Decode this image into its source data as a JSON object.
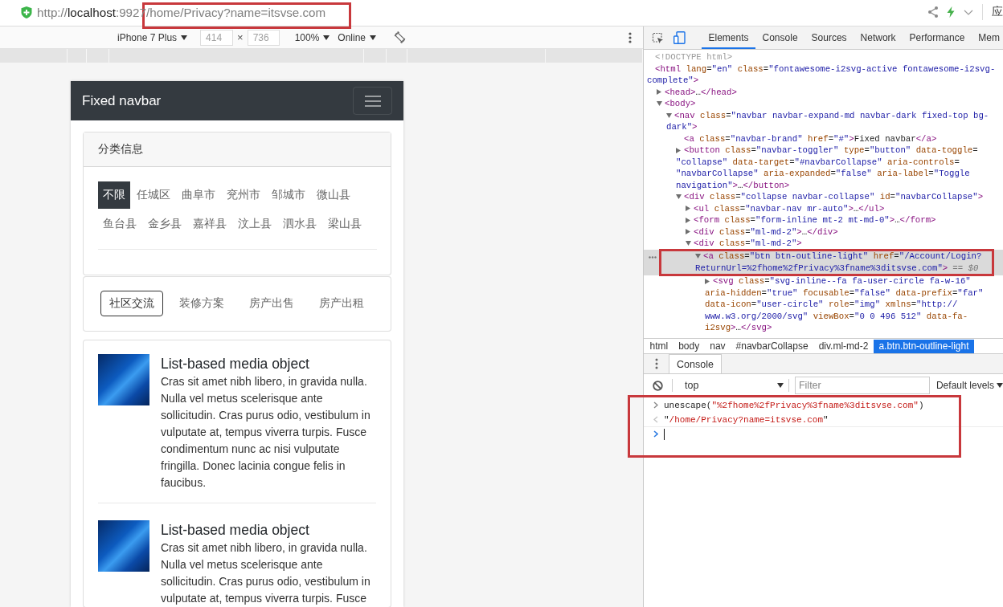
{
  "browser": {
    "url": {
      "scheme": "http://",
      "host": "localhost",
      "path": ":9927/home/Privacy?name=itsvse.com"
    },
    "menu_label": "应"
  },
  "device_toolbar": {
    "device": "iPhone 7 Plus",
    "width": {
      "value": "414",
      "disabled": true
    },
    "times": "×",
    "height": {
      "value": "736",
      "disabled": true
    },
    "zoom": "100%",
    "throttling": "Online"
  },
  "page": {
    "navbar": {
      "brand": "Fixed navbar"
    },
    "category_card": {
      "title": "分类信息",
      "filters": [
        {
          "label": "不限",
          "selected": true
        },
        {
          "label": "任城区",
          "selected": false
        },
        {
          "label": "曲阜市",
          "selected": false
        },
        {
          "label": "兖州市",
          "selected": false
        },
        {
          "label": "邹城市",
          "selected": false
        },
        {
          "label": "微山县",
          "selected": false
        },
        {
          "label": "鱼台县",
          "selected": false
        },
        {
          "label": "金乡县",
          "selected": false
        },
        {
          "label": "嘉祥县",
          "selected": false
        },
        {
          "label": "汶上县",
          "selected": false
        },
        {
          "label": "泗水县",
          "selected": false
        },
        {
          "label": "梁山县",
          "selected": false
        }
      ]
    },
    "tabs": [
      {
        "label": "社区交流",
        "selected": true
      },
      {
        "label": "装修方案",
        "selected": false
      },
      {
        "label": "房产出售",
        "selected": false
      },
      {
        "label": "房产出租",
        "selected": false
      }
    ],
    "media_list": [
      {
        "title": "List-based media object",
        "body": "Cras sit amet nibh libero, in gravida nulla. Nulla vel metus scelerisque ante sollicitudin. Cras purus odio, vestibulum in vulputate at, tempus viverra turpis. Fusce condimentum nunc ac nisi vulputate fringilla. Donec lacinia congue felis in faucibus."
      },
      {
        "title": "List-based media object",
        "body": "Cras sit amet nibh libero, in gravida nulla. Nulla vel metus scelerisque ante sollicitudin. Cras purus odio, vestibulum in vulputate at, tempus viverra turpis. Fusce"
      }
    ]
  },
  "devtools": {
    "tabs": [
      {
        "label": "Elements",
        "selected": true
      },
      {
        "label": "Console",
        "selected": false
      },
      {
        "label": "Sources",
        "selected": false
      },
      {
        "label": "Network",
        "selected": false
      },
      {
        "label": "Performance",
        "selected": false
      },
      {
        "label": "Mem",
        "selected": false
      }
    ],
    "dom_tree": [
      {
        "kind": "doctype",
        "selected": false,
        "lines": [
          "<!DOCTYPE html>"
        ]
      },
      {
        "kind": "element",
        "selected": false,
        "lines": [
          "<html lang=\"en\" class=\"fontawesome-i2svg-active fontawesome-i2svg-",
          "complete\">"
        ],
        "children": [
          {
            "kind": "element",
            "expanded": false,
            "selected": false,
            "lines": [
              "<head>…</head>"
            ]
          },
          {
            "kind": "element",
            "expanded": true,
            "selected": false,
            "lines": [
              "<body>"
            ],
            "children": [
              {
                "kind": "element",
                "expanded": true,
                "selected": false,
                "lines": [
                  "<nav class=\"navbar navbar-expand-md navbar-dark fixed-top bg-",
                  "dark\">"
                ],
                "children": [
                  {
                    "kind": "element",
                    "selected": false,
                    "lines": [
                      "<a class=\"navbar-brand\" href=\"#\">Fixed navbar</a>"
                    ]
                  },
                  {
                    "kind": "element",
                    "expanded": false,
                    "selected": false,
                    "lines": [
                      "<button class=\"navbar-toggler\" type=\"button\" data-toggle=",
                      "\"collapse\" data-target=\"#navbarCollapse\" aria-controls=",
                      "\"navbarCollapse\" aria-expanded=\"false\" aria-label=\"Toggle",
                      "navigation\">…</button>"
                    ]
                  },
                  {
                    "kind": "element",
                    "expanded": true,
                    "selected": false,
                    "lines": [
                      "<div class=\"collapse navbar-collapse\" id=\"navbarCollapse\">"
                    ],
                    "children": [
                      {
                        "kind": "element",
                        "expanded": false,
                        "selected": false,
                        "lines": [
                          "<ul class=\"navbar-nav mr-auto\">…</ul>"
                        ]
                      },
                      {
                        "kind": "element",
                        "expanded": false,
                        "selected": false,
                        "lines": [
                          "<form class=\"form-inline mt-2 mt-md-0\">…</form>"
                        ]
                      },
                      {
                        "kind": "element",
                        "expanded": false,
                        "selected": false,
                        "lines": [
                          "<div class=\"ml-md-2\">…</div>"
                        ]
                      },
                      {
                        "kind": "element",
                        "expanded": true,
                        "selected": false,
                        "lines": [
                          "<div class=\"ml-md-2\">"
                        ],
                        "children": [
                          {
                            "kind": "element",
                            "expanded": true,
                            "selected": true,
                            "lines": [
                              "<a class=\"btn btn-outline-light\" href=\"/Account/Login?",
                              "ReturnUrl=%2fhome%2fPrivacy%3fname%3ditsvse.com\">"
                            ],
                            "note": "== $0",
                            "children": [
                              {
                                "kind": "element",
                                "expanded": false,
                                "selected": false,
                                "lines": [
                                  "<svg class=\"svg-inline--fa fa-user-circle fa-w-16\"",
                                  "aria-hidden=\"true\" focusable=\"false\" data-prefix=\"far\"",
                                  "data-icon=\"user-circle\" role=\"img\" xmlns=\"http://",
                                  "www.w3.org/2000/svg\" viewBox=\"0 0 496 512\" data-fa-",
                                  "i2svg>…</svg>"
                                ]
                              }
                            ]
                          }
                        ]
                      }
                    ]
                  }
                ]
              }
            ]
          }
        ]
      }
    ],
    "breadcrumbs": [
      {
        "label": "html",
        "selected": false
      },
      {
        "label": "body",
        "selected": false
      },
      {
        "label": "nav",
        "selected": false
      },
      {
        "label": "#navbarCollapse",
        "selected": false
      },
      {
        "label": "div.ml-md-2",
        "selected": false
      },
      {
        "label": "a.btn.btn-outline-light",
        "selected": true
      }
    ],
    "drawer": {
      "tabs": [
        {
          "label": "Console",
          "selected": true
        }
      ],
      "context": "top",
      "filter": {
        "placeholder": "Filter"
      },
      "levels": "Default levels",
      "messages": [
        {
          "kind": "command",
          "text": "unescape(\"%2fhome%2fPrivacy%3fname%3ditsvse.com\")"
        },
        {
          "kind": "result",
          "text": "\"/home/Privacy?name=itsvse.com\""
        },
        {
          "kind": "prompt"
        }
      ]
    }
  }
}
